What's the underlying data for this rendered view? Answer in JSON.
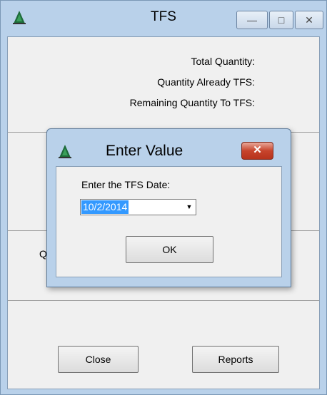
{
  "window": {
    "title": "TFS",
    "minimize_glyph": "—",
    "maximize_glyph": "□",
    "close_glyph": "✕"
  },
  "labels": {
    "total_quantity": "Total Quantity:",
    "quantity_already_tfs": "Quantity Already TFS:",
    "remaining_quantity": "Remaining Quantity To TFS:",
    "partial_q": "Q"
  },
  "buttons": {
    "close": "Close",
    "reports": "Reports"
  },
  "dialog": {
    "title": "Enter Value",
    "close_glyph": "✕",
    "prompt": "Enter the TFS Date:",
    "date_value": "10/2/2014",
    "dropdown_glyph": "▼",
    "ok": "OK"
  },
  "icons": {
    "app": "tree-logo-icon"
  }
}
